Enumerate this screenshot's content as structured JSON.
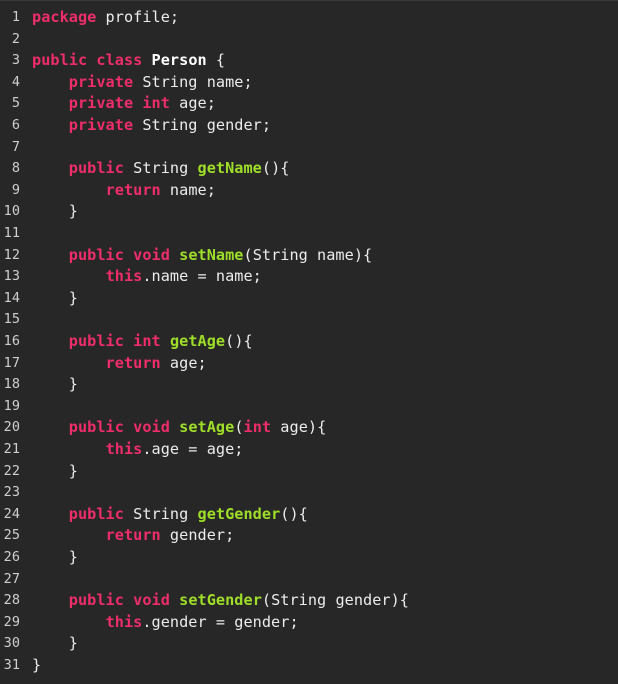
{
  "editor": {
    "language": "java",
    "colors": {
      "background": "#272727",
      "keyword": "#ee2d6b",
      "function": "#9fde28",
      "text": "#ececec",
      "line_number": "#cfcfcf"
    },
    "lines": [
      {
        "n": "1",
        "tokens": [
          [
            "kw",
            "package"
          ],
          [
            "txt",
            " profile;"
          ]
        ]
      },
      {
        "n": "2",
        "tokens": []
      },
      {
        "n": "3",
        "tokens": [
          [
            "kw",
            "public"
          ],
          [
            "txt",
            " "
          ],
          [
            "kw",
            "class"
          ],
          [
            "txt",
            " "
          ],
          [
            "cls",
            "Person"
          ],
          [
            "txt",
            " {"
          ]
        ]
      },
      {
        "n": "4",
        "tokens": [
          [
            "txt",
            "    "
          ],
          [
            "kw",
            "private"
          ],
          [
            "txt",
            " String name;"
          ]
        ]
      },
      {
        "n": "5",
        "tokens": [
          [
            "txt",
            "    "
          ],
          [
            "kw",
            "private"
          ],
          [
            "txt",
            " "
          ],
          [
            "kw",
            "int"
          ],
          [
            "txt",
            " age;"
          ]
        ]
      },
      {
        "n": "6",
        "tokens": [
          [
            "txt",
            "    "
          ],
          [
            "kw",
            "private"
          ],
          [
            "txt",
            " String gender;"
          ]
        ]
      },
      {
        "n": "7",
        "tokens": []
      },
      {
        "n": "8",
        "tokens": [
          [
            "txt",
            "    "
          ],
          [
            "kw",
            "public"
          ],
          [
            "txt",
            " String "
          ],
          [
            "fn",
            "getName"
          ],
          [
            "txt",
            "(){"
          ]
        ]
      },
      {
        "n": "9",
        "tokens": [
          [
            "txt",
            "        "
          ],
          [
            "kw",
            "return"
          ],
          [
            "txt",
            " name;"
          ]
        ]
      },
      {
        "n": "10",
        "tokens": [
          [
            "txt",
            "    }"
          ]
        ]
      },
      {
        "n": "11",
        "tokens": []
      },
      {
        "n": "12",
        "tokens": [
          [
            "txt",
            "    "
          ],
          [
            "kw",
            "public"
          ],
          [
            "txt",
            " "
          ],
          [
            "kw",
            "void"
          ],
          [
            "txt",
            " "
          ],
          [
            "fn",
            "setName"
          ],
          [
            "txt",
            "(String name){"
          ]
        ]
      },
      {
        "n": "13",
        "tokens": [
          [
            "txt",
            "        "
          ],
          [
            "kw",
            "this"
          ],
          [
            "txt",
            ".name = name;"
          ]
        ]
      },
      {
        "n": "14",
        "tokens": [
          [
            "txt",
            "    }"
          ]
        ]
      },
      {
        "n": "15",
        "tokens": []
      },
      {
        "n": "16",
        "tokens": [
          [
            "txt",
            "    "
          ],
          [
            "kw",
            "public"
          ],
          [
            "txt",
            " "
          ],
          [
            "kw",
            "int"
          ],
          [
            "txt",
            " "
          ],
          [
            "fn",
            "getAge"
          ],
          [
            "txt",
            "(){"
          ]
        ]
      },
      {
        "n": "17",
        "tokens": [
          [
            "txt",
            "        "
          ],
          [
            "kw",
            "return"
          ],
          [
            "txt",
            " age;"
          ]
        ]
      },
      {
        "n": "18",
        "tokens": [
          [
            "txt",
            "    }"
          ]
        ]
      },
      {
        "n": "19",
        "tokens": []
      },
      {
        "n": "20",
        "tokens": [
          [
            "txt",
            "    "
          ],
          [
            "kw",
            "public"
          ],
          [
            "txt",
            " "
          ],
          [
            "kw",
            "void"
          ],
          [
            "txt",
            " "
          ],
          [
            "fn",
            "setAge"
          ],
          [
            "txt",
            "("
          ],
          [
            "kw",
            "int"
          ],
          [
            "txt",
            " age){"
          ]
        ]
      },
      {
        "n": "21",
        "tokens": [
          [
            "txt",
            "        "
          ],
          [
            "kw",
            "this"
          ],
          [
            "txt",
            ".age = age;"
          ]
        ]
      },
      {
        "n": "22",
        "tokens": [
          [
            "txt",
            "    }"
          ]
        ]
      },
      {
        "n": "23",
        "tokens": []
      },
      {
        "n": "24",
        "tokens": [
          [
            "txt",
            "    "
          ],
          [
            "kw",
            "public"
          ],
          [
            "txt",
            " String "
          ],
          [
            "fn",
            "getGender"
          ],
          [
            "txt",
            "(){"
          ]
        ]
      },
      {
        "n": "25",
        "tokens": [
          [
            "txt",
            "        "
          ],
          [
            "kw",
            "return"
          ],
          [
            "txt",
            " gender;"
          ]
        ]
      },
      {
        "n": "26",
        "tokens": [
          [
            "txt",
            "    }"
          ]
        ]
      },
      {
        "n": "27",
        "tokens": []
      },
      {
        "n": "28",
        "tokens": [
          [
            "txt",
            "    "
          ],
          [
            "kw",
            "public"
          ],
          [
            "txt",
            " "
          ],
          [
            "kw",
            "void"
          ],
          [
            "txt",
            " "
          ],
          [
            "fn",
            "setGender"
          ],
          [
            "txt",
            "(String gender){"
          ]
        ]
      },
      {
        "n": "29",
        "tokens": [
          [
            "txt",
            "        "
          ],
          [
            "kw",
            "this"
          ],
          [
            "txt",
            ".gender = gender;"
          ]
        ]
      },
      {
        "n": "30",
        "tokens": [
          [
            "txt",
            "    }"
          ]
        ]
      },
      {
        "n": "31",
        "tokens": [
          [
            "txt",
            "}"
          ]
        ]
      }
    ]
  }
}
